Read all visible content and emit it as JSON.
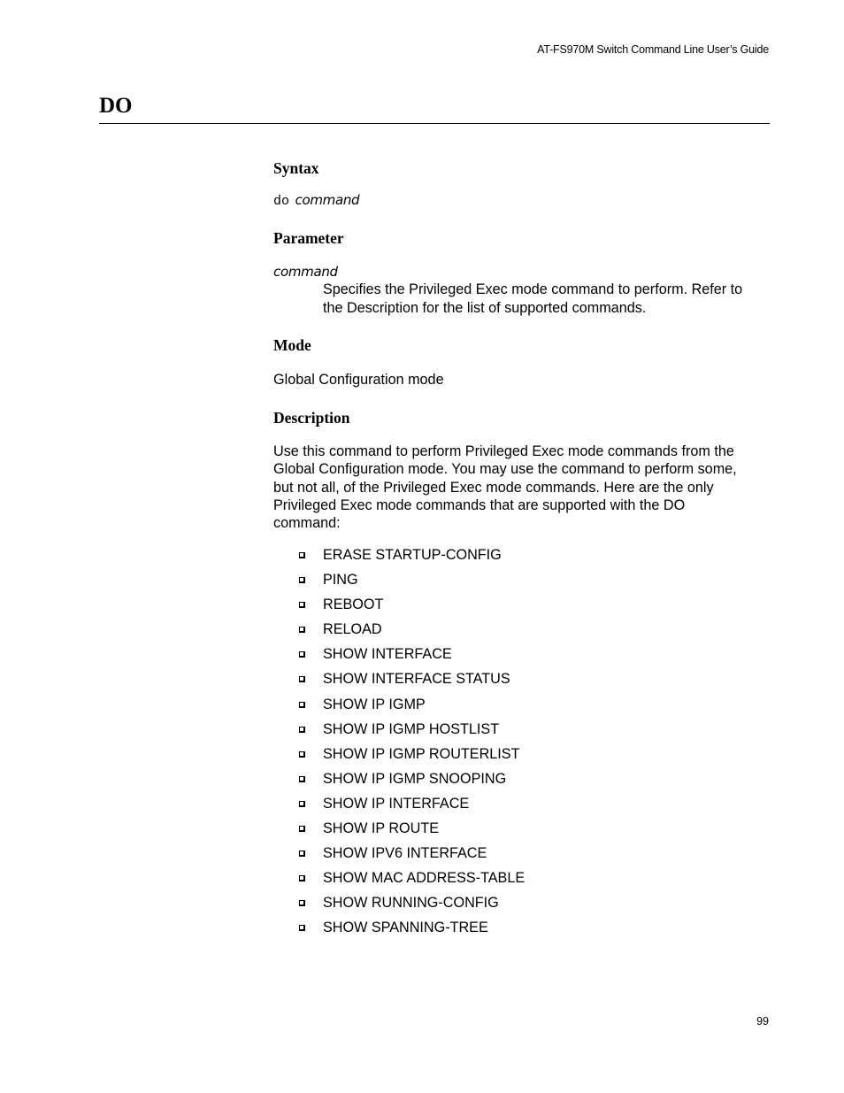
{
  "header": {
    "running_title": "AT-FS970M Switch Command Line User’s Guide"
  },
  "title": "DO",
  "sections": {
    "syntax": {
      "heading": "Syntax",
      "keyword": "do",
      "argument": "command"
    },
    "parameter": {
      "heading": "Parameter",
      "name": "command",
      "description_line1": "Specifies the Privileged Exec mode command to perform. Refer to",
      "description_line2": "the Description for the list of supported commands."
    },
    "mode": {
      "heading": "Mode",
      "text": "Global Configuration mode"
    },
    "description": {
      "heading": "Description",
      "lines": [
        "Use this command to perform Privileged Exec mode commands from the",
        "Global Configuration mode. You may use the command to perform some,",
        "but not all, of the Privileged Exec mode commands. Here are the only",
        "Privileged Exec mode commands that are supported with the DO",
        "command:"
      ],
      "commands": [
        "ERASE STARTUP-CONFIG",
        "PING",
        "REBOOT",
        "RELOAD",
        "SHOW INTERFACE",
        "SHOW INTERFACE STATUS",
        "SHOW IP IGMP",
        "SHOW IP IGMP HOSTLIST",
        "SHOW IP IGMP ROUTERLIST",
        "SHOW IP IGMP SNOOPING",
        "SHOW IP INTERFACE",
        "SHOW IP ROUTE",
        "SHOW IPV6 INTERFACE",
        "SHOW MAC ADDRESS-TABLE",
        "SHOW RUNNING-CONFIG",
        "SHOW SPANNING-TREE"
      ],
      "bullet_icon": "square-bullet-icon"
    }
  },
  "footer": {
    "page_number": "99"
  }
}
